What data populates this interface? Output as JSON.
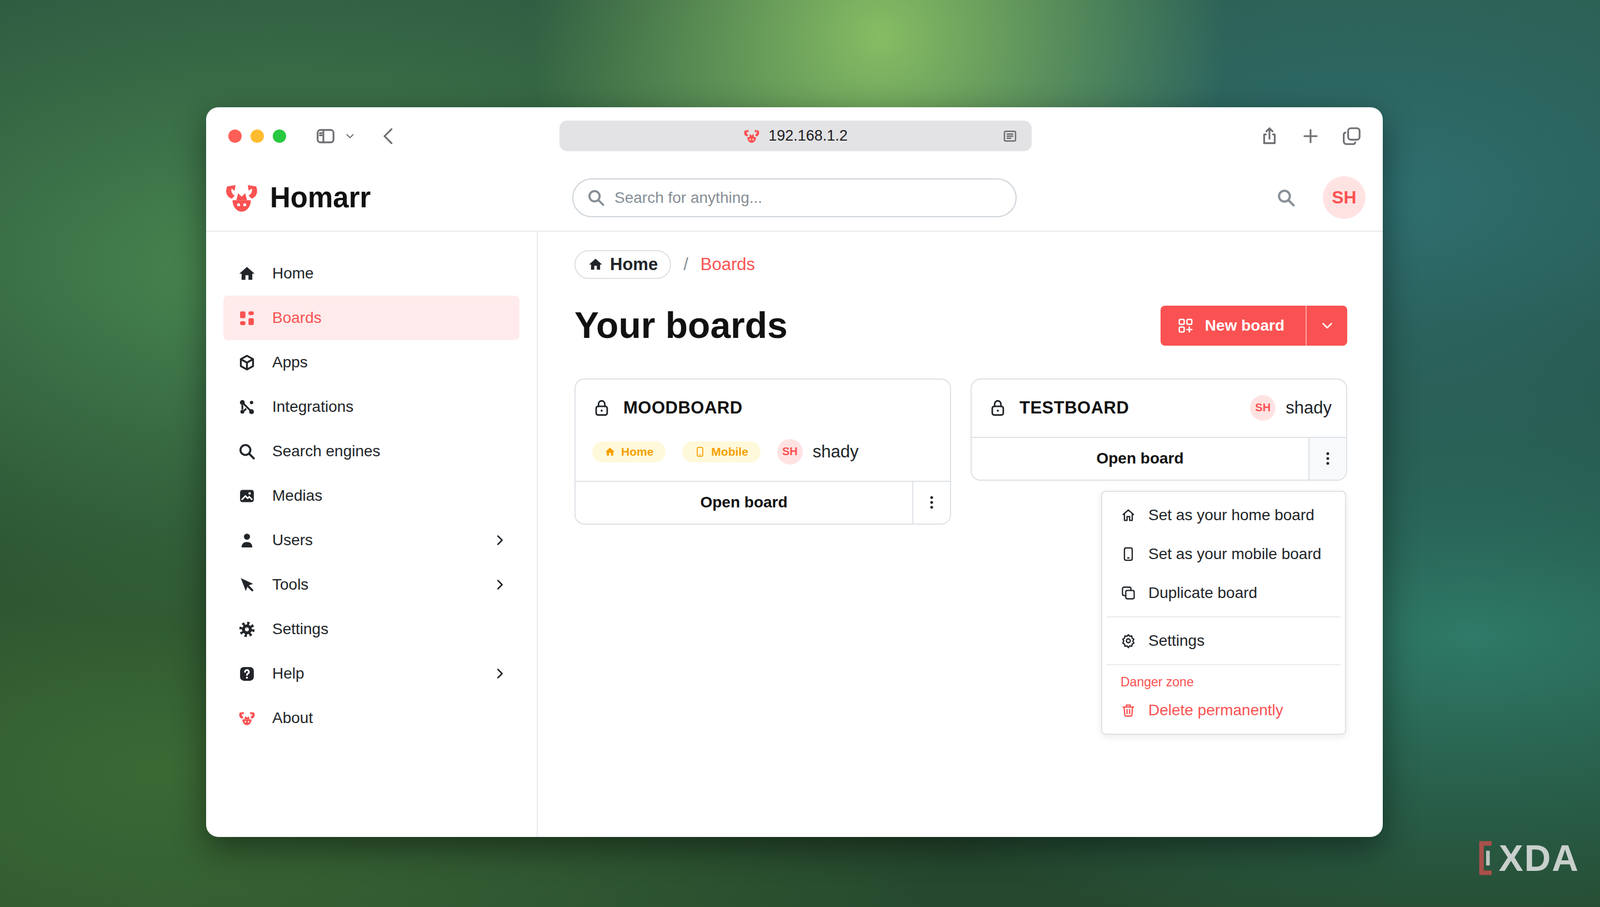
{
  "desktop": {
    "watermark": "XDA"
  },
  "window": {
    "address": "192.168.1.2"
  },
  "header": {
    "app_name": "Homarr",
    "search_placeholder": "Search for anything...",
    "user_initials": "SH"
  },
  "sidebar": {
    "items": [
      {
        "label": "Home",
        "selected": false,
        "expandable": false
      },
      {
        "label": "Boards",
        "selected": true,
        "expandable": false
      },
      {
        "label": "Apps",
        "selected": false,
        "expandable": false
      },
      {
        "label": "Integrations",
        "selected": false,
        "expandable": false
      },
      {
        "label": "Search engines",
        "selected": false,
        "expandable": false
      },
      {
        "label": "Medias",
        "selected": false,
        "expandable": false
      },
      {
        "label": "Users",
        "selected": false,
        "expandable": true
      },
      {
        "label": "Tools",
        "selected": false,
        "expandable": true
      },
      {
        "label": "Settings",
        "selected": false,
        "expandable": false
      },
      {
        "label": "Help",
        "selected": false,
        "expandable": true
      },
      {
        "label": "About",
        "selected": false,
        "expandable": false
      }
    ]
  },
  "breadcrumb": {
    "items": [
      {
        "label": "Home",
        "selected": false
      },
      {
        "label": "Boards",
        "selected": true
      }
    ],
    "separator": "/"
  },
  "page": {
    "title": "Your boards",
    "new_button": "New board"
  },
  "boards": [
    {
      "name": "MOODBOARD",
      "locked": true,
      "tags": [
        "Home",
        "Mobile"
      ],
      "owner_initials": "SH",
      "owner": "shady",
      "open_label": "Open board",
      "menu_open": false
    },
    {
      "name": "TESTBOARD",
      "locked": true,
      "tags": [],
      "owner_initials": "SH",
      "owner": "shady",
      "open_label": "Open board",
      "menu_open": true
    }
  ],
  "board_menu": {
    "sections": [
      {
        "label": "",
        "items": [
          {
            "label": "Set as your home board",
            "kind": "normal"
          },
          {
            "label": "Set as your mobile board",
            "kind": "normal"
          },
          {
            "label": "Duplicate board",
            "kind": "normal"
          }
        ]
      },
      {
        "label": "",
        "items": [
          {
            "label": "Settings",
            "kind": "normal"
          }
        ]
      },
      {
        "label": "Danger zone",
        "items": [
          {
            "label": "Delete permanently",
            "kind": "danger"
          }
        ]
      }
    ]
  }
}
